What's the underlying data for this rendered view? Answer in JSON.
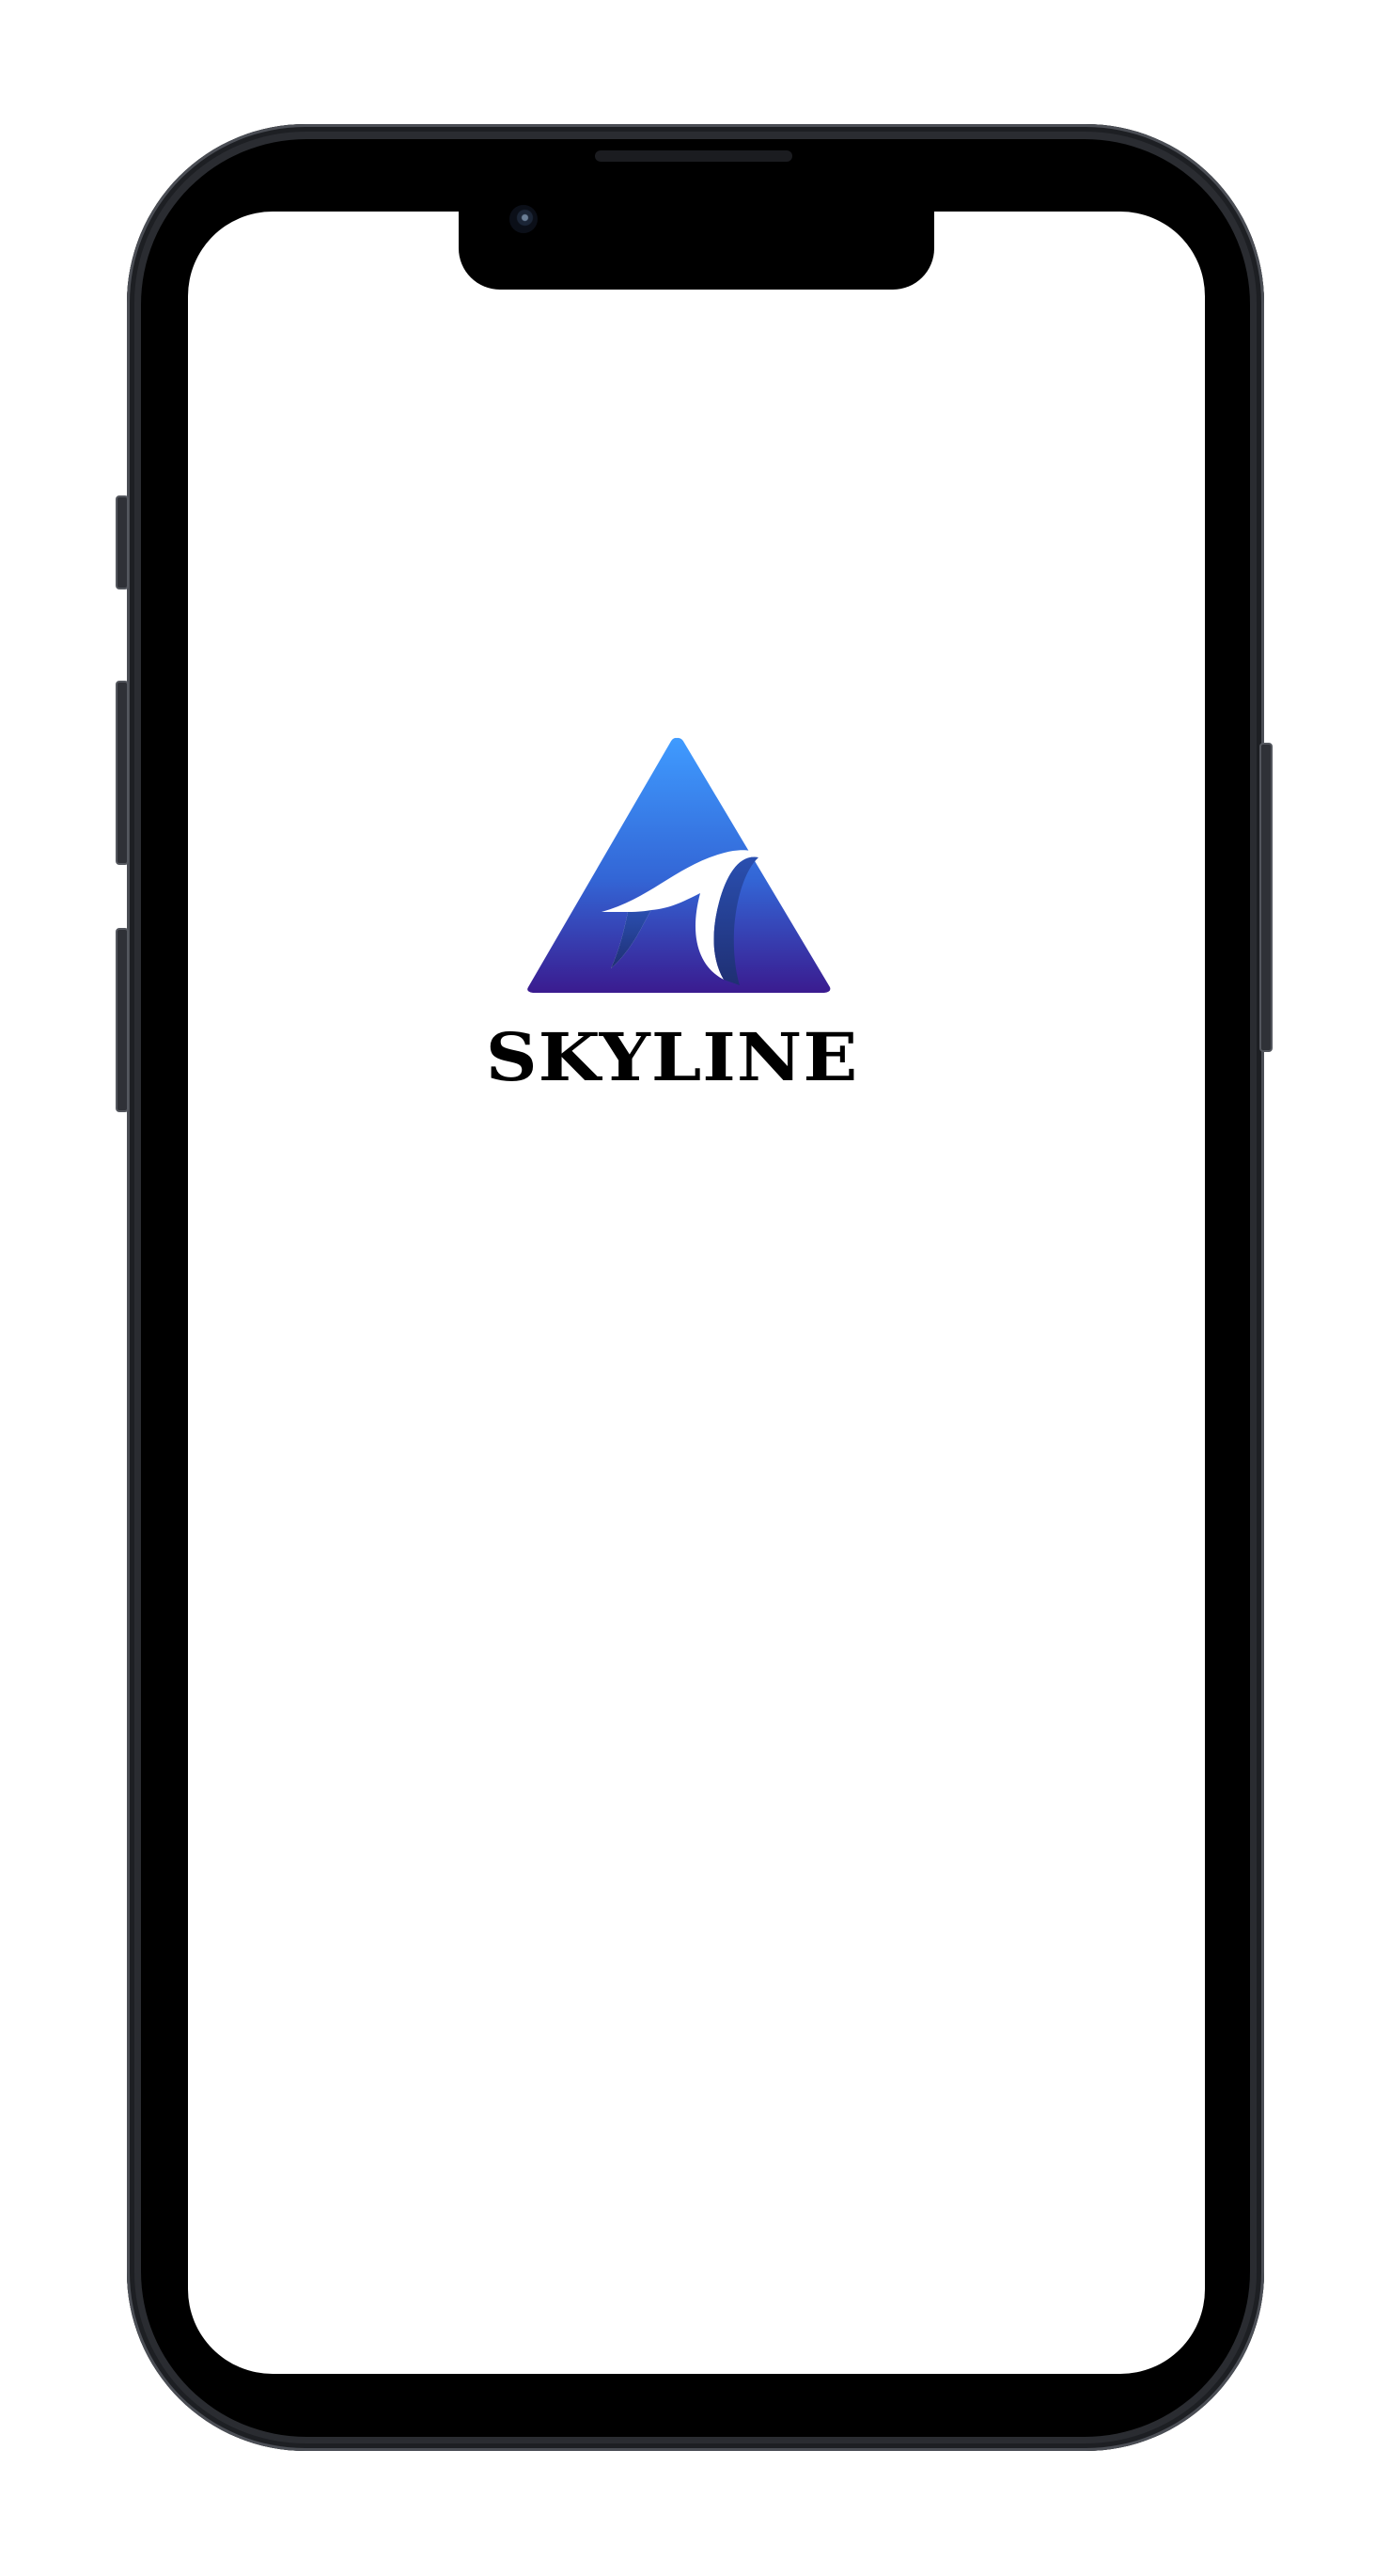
{
  "app": {
    "logo_text": "SKYLINE",
    "logo_icon": "mountain-wave-logo-icon"
  },
  "colors": {
    "logo_gradient_top": "#3f9bff",
    "logo_gradient_bottom": "#3a1b8f",
    "logo_accent": "#1f2f73"
  }
}
